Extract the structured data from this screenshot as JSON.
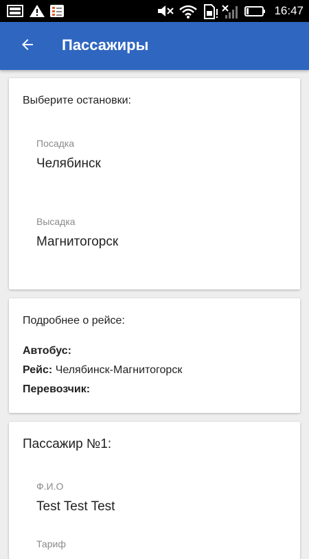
{
  "status_bar": {
    "time": "16:47",
    "icons": [
      "gallery-icon",
      "warning-icon",
      "checklist-icon",
      "mute-icon",
      "wifi-icon",
      "sim-icon",
      "no-signal-icon",
      "battery-icon"
    ]
  },
  "app_bar": {
    "title": "Пассажиры",
    "back_icon": "arrow-left-icon",
    "color": "#2f66c0"
  },
  "stops_card": {
    "heading": "Выберите остановки:",
    "boarding": {
      "label": "Посадка",
      "value": "Челябинск"
    },
    "alighting": {
      "label": "Высадка",
      "value": "Магнитогорск"
    }
  },
  "trip_card": {
    "heading": "Подробнее о рейсе:",
    "bus": {
      "label": "Автобус:",
      "value": ""
    },
    "route": {
      "label": "Рейс:",
      "value": "Челябинск-Магнитогорск"
    },
    "carrier": {
      "label": "Перевозчик:",
      "value": ""
    }
  },
  "passenger_card": {
    "heading": "Пассажир №1:",
    "name": {
      "label": "Ф.И.О",
      "value": "Test Test Test"
    },
    "tariff": {
      "label": "Тариф"
    }
  }
}
